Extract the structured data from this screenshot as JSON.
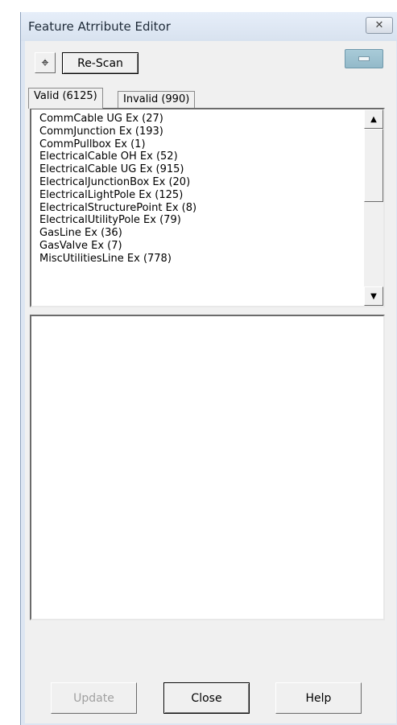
{
  "window": {
    "title": "Feature Atrribute Editor",
    "close_glyph": "✕"
  },
  "toolbar": {
    "crosshair_glyph": "⌖",
    "rescan_label": "Re-Scan"
  },
  "tabs": [
    {
      "label": "Valid (6125)",
      "selected": true
    },
    {
      "label": "Invalid (990)",
      "selected": false
    }
  ],
  "feature_list": {
    "items": [
      "CommCable UG Ex (27)",
      "CommJunction Ex (193)",
      "CommPullbox Ex (1)",
      "ElectricalCable OH Ex (52)",
      "ElectricalCable UG Ex (915)",
      "ElectricalJunctionBox Ex (20)",
      "ElectricalLightPole Ex (125)",
      "ElectricalStructurePoint Ex (8)",
      "ElectricalUtilityPole Ex (79)",
      "GasLine Ex (36)",
      "GasValve Ex (7)",
      "MiscUtilitiesLine Ex (778)"
    ],
    "scroll_up_glyph": "▲",
    "scroll_down_glyph": "▼"
  },
  "buttons": {
    "update_label": "Update",
    "close_label": "Close",
    "help_label": "Help"
  },
  "colors": {
    "window_frame": "#dde6f2",
    "dialog_background": "#f0f0f0",
    "disabled_text": "#a0a0a0"
  },
  "icons": {
    "crosshair": "crosshair-icon",
    "close": "close-icon",
    "minimize": "minimize-icon"
  }
}
